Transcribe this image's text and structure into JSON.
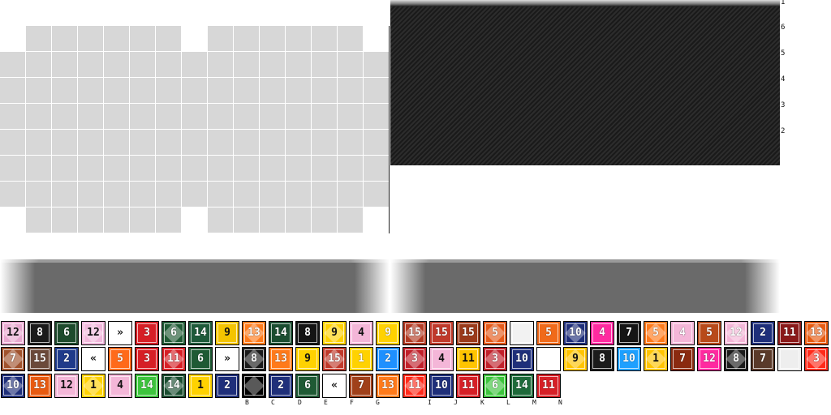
{
  "board": {
    "row_numbers": [
      "1",
      "6",
      "5",
      "4",
      "3",
      "2"
    ]
  },
  "column_letters": [
    "B",
    "C",
    "D",
    "E",
    "F",
    "G",
    "I",
    "J",
    "K",
    "L",
    "M",
    "N"
  ],
  "tiles": {
    "row1": [
      {
        "label": "12",
        "bg": "#e8a9d0",
        "fg": "dark"
      },
      {
        "label": "8",
        "bg": "#1b1b1b",
        "fg": "light"
      },
      {
        "label": "6",
        "bg": "#1d4a2c",
        "fg": "light"
      },
      {
        "label": "12",
        "bg": "#f2b8dc",
        "fg": "dark"
      },
      {
        "label": "»",
        "bg": "#ffffff",
        "fg": "dark"
      },
      {
        "label": "3",
        "bg": "#d61f26",
        "fg": "light"
      },
      {
        "label": "6",
        "bg": "#1f5a34",
        "fg": "light"
      },
      {
        "label": "14",
        "bg": "#1e5a3a",
        "fg": "light"
      },
      {
        "label": "9",
        "bg": "#f4c400",
        "fg": "dark"
      },
      {
        "label": "13",
        "bg": "#ff7a1a",
        "fg": "light"
      },
      {
        "label": "14",
        "bg": "#1a4d30",
        "fg": "light"
      },
      {
        "label": "8",
        "bg": "#141414",
        "fg": "light"
      },
      {
        "label": "9",
        "bg": "#ffd200",
        "fg": "dark"
      },
      {
        "label": "4",
        "bg": "#f4b6d8",
        "fg": "dark"
      },
      {
        "label": "9",
        "bg": "#ffd200",
        "fg": "light"
      },
      {
        "label": "15",
        "bg": "#b23a23",
        "fg": "light"
      },
      {
        "label": "15",
        "bg": "#c0392b",
        "fg": "light"
      },
      {
        "label": "15",
        "bg": "#9a3a1a",
        "fg": "light"
      },
      {
        "label": "5",
        "bg": "#e55a1a",
        "fg": "light"
      },
      {
        "label": "",
        "bg": "#f2f2f2",
        "fg": "dark"
      },
      {
        "label": "5",
        "bg": "#f06a1a",
        "fg": "light"
      },
      {
        "label": "10",
        "bg": "#1f2f7a",
        "fg": "light"
      },
      {
        "label": "4",
        "bg": "#ff2aa0",
        "fg": "light"
      },
      {
        "label": "7",
        "bg": "#151515",
        "fg": "light"
      },
      {
        "label": "5",
        "bg": "#ff7a1a",
        "fg": "light"
      },
      {
        "label": "4",
        "bg": "#f4b6d8",
        "fg": "light"
      },
      {
        "label": "5",
        "bg": "#b84a1a",
        "fg": "light"
      },
      {
        "label": "12",
        "bg": "#f4b6d8",
        "fg": "light"
      },
      {
        "label": "2",
        "bg": "#1f2f7a",
        "fg": "light"
      },
      {
        "label": "11",
        "bg": "#8a1a1a",
        "fg": "light"
      },
      {
        "label": "13",
        "bg": "#e85a10",
        "fg": "light"
      }
    ],
    "row2": [
      {
        "label": "7",
        "bg": "#a0522d",
        "fg": "light"
      },
      {
        "label": "15",
        "bg": "#6b4a3a",
        "fg": "light"
      },
      {
        "label": "2",
        "bg": "#1f3a8a",
        "fg": "light"
      },
      {
        "label": "«",
        "bg": "#ffffff",
        "fg": "dark"
      },
      {
        "label": "5",
        "bg": "#ff6a1a",
        "fg": "light"
      },
      {
        "label": "3",
        "bg": "#d61f26",
        "fg": "light"
      },
      {
        "label": "11",
        "bg": "#d61f26",
        "fg": "light"
      },
      {
        "label": "6",
        "bg": "#1f5a34",
        "fg": "light"
      },
      {
        "label": "»",
        "bg": "#ffffff",
        "fg": "dark"
      },
      {
        "label": "8",
        "bg": "#1b1b1b",
        "fg": "light"
      },
      {
        "label": "13",
        "bg": "#ff7a1a",
        "fg": "light"
      },
      {
        "label": "9",
        "bg": "#ffd200",
        "fg": "dark"
      },
      {
        "label": "15",
        "bg": "#c0392b",
        "fg": "light"
      },
      {
        "label": "1",
        "bg": "#ffd200",
        "fg": "light"
      },
      {
        "label": "2",
        "bg": "#1e90ff",
        "fg": "light"
      },
      {
        "label": "3",
        "bg": "#c0202a",
        "fg": "light"
      },
      {
        "label": "4",
        "bg": "#f4b6d8",
        "fg": "dark"
      },
      {
        "label": "11",
        "bg": "#ffc400",
        "fg": "dark"
      },
      {
        "label": "3",
        "bg": "#c0202a",
        "fg": "light"
      },
      {
        "label": "10",
        "bg": "#1f2f7a",
        "fg": "light"
      },
      {
        "label": "",
        "bg": "#ffffff",
        "fg": "dark"
      },
      {
        "label": "9",
        "bg": "#ffc400",
        "fg": "dark"
      },
      {
        "label": "8",
        "bg": "#1b1b1b",
        "fg": "light"
      },
      {
        "label": "10",
        "bg": "#1ea0ff",
        "fg": "light"
      },
      {
        "label": "1",
        "bg": "#ffc400",
        "fg": "dark"
      },
      {
        "label": "7",
        "bg": "#8a2a10",
        "fg": "light"
      },
      {
        "label": "12",
        "bg": "#ff2aa0",
        "fg": "light"
      },
      {
        "label": "8",
        "bg": "#1b1b1b",
        "fg": "light"
      },
      {
        "label": "7",
        "bg": "#5a3a2a",
        "fg": "light"
      },
      {
        "label": "",
        "bg": "#eeeeee",
        "fg": "dark"
      },
      {
        "label": "3",
        "bg": "#ff2a1a",
        "fg": "light"
      }
    ],
    "row3": [
      {
        "label": "10",
        "bg": "#1f2f7a",
        "fg": "light"
      },
      {
        "label": "13",
        "bg": "#e85a10",
        "fg": "light"
      },
      {
        "label": "12",
        "bg": "#f4b6d8",
        "fg": "dark"
      },
      {
        "label": "1",
        "bg": "#ffd200",
        "fg": "dark"
      },
      {
        "label": "4",
        "bg": "#f4b6d8",
        "fg": "dark"
      },
      {
        "label": "14",
        "bg": "#3cc43c",
        "fg": "light"
      },
      {
        "label": "14",
        "bg": "#1a4d30",
        "fg": "light"
      },
      {
        "label": "1",
        "bg": "#ffd200",
        "fg": "dark"
      },
      {
        "label": "2",
        "bg": "#1f2f7a",
        "fg": "light"
      },
      {
        "label": "",
        "bg": "#000000",
        "fg": "light"
      },
      {
        "label": "2",
        "bg": "#1f2f7a",
        "fg": "light"
      },
      {
        "label": "6",
        "bg": "#1f5a34",
        "fg": "light"
      },
      {
        "label": "«",
        "bg": "#ffffff",
        "fg": "dark"
      },
      {
        "label": "7",
        "bg": "#a0401a",
        "fg": "light"
      },
      {
        "label": "13",
        "bg": "#ff7a1a",
        "fg": "light"
      },
      {
        "label": "11",
        "bg": "#ff2a1a",
        "fg": "light"
      },
      {
        "label": "10",
        "bg": "#1f2f7a",
        "fg": "light"
      },
      {
        "label": "11",
        "bg": "#d61f26",
        "fg": "light"
      },
      {
        "label": "6",
        "bg": "#3cc43c",
        "fg": "light"
      },
      {
        "label": "14",
        "bg": "#1e6a3a",
        "fg": "light"
      },
      {
        "label": "11",
        "bg": "#d61f26",
        "fg": "light"
      }
    ]
  }
}
